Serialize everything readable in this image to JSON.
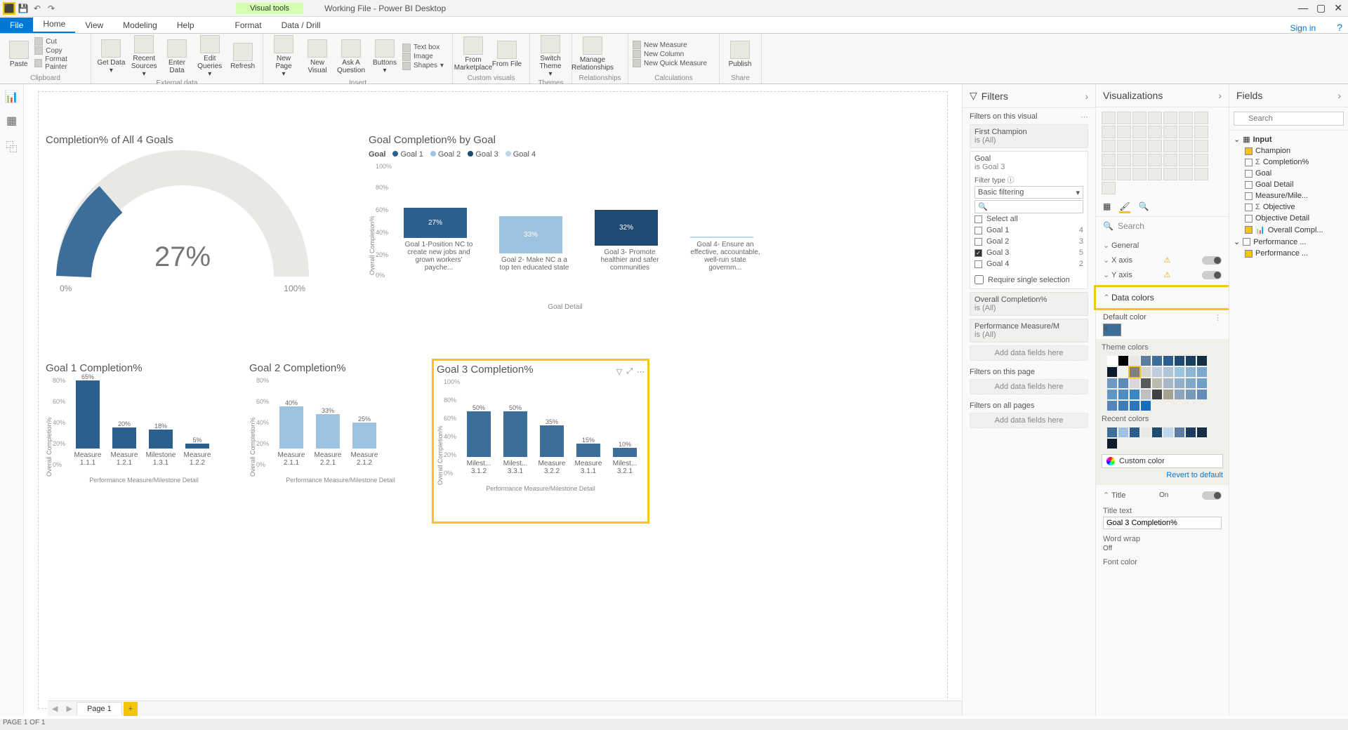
{
  "app": {
    "title": "Working File - Power BI Desktop",
    "visual_tools": "Visual tools",
    "sign_in": "Sign in"
  },
  "tabs": {
    "file": "File",
    "home": "Home",
    "view": "View",
    "modeling": "Modeling",
    "help": "Help",
    "format": "Format",
    "datadrill": "Data / Drill"
  },
  "ribbon": {
    "clipboard": {
      "paste": "Paste",
      "cut": "Cut",
      "copy": "Copy",
      "format_painter": "Format Painter",
      "label": "Clipboard"
    },
    "external": {
      "get_data": "Get Data",
      "recent_sources": "Recent Sources",
      "enter_data": "Enter Data",
      "edit_queries": "Edit Queries",
      "refresh": "Refresh",
      "label": "External data"
    },
    "insert": {
      "new_page": "New Page",
      "new_visual": "New Visual",
      "ask": "Ask A Question",
      "buttons": "Buttons",
      "textbox": "Text box",
      "image": "Image",
      "shapes": "Shapes",
      "label": "Insert"
    },
    "custom": {
      "marketplace": "From Marketplace",
      "file": "From File",
      "label": "Custom visuals"
    },
    "themes": {
      "switch": "Switch Theme",
      "label": "Themes"
    },
    "rel": {
      "manage": "Manage Relationships",
      "label": "Relationships"
    },
    "calc": {
      "new_measure": "New Measure",
      "new_column": "New Column",
      "quick": "New Quick Measure",
      "label": "Calculations"
    },
    "share": {
      "publish": "Publish",
      "label": "Share"
    }
  },
  "page_tab": "Page 1",
  "status": "PAGE 1 OF 1",
  "chart_data": [
    {
      "type": "gauge",
      "title": "Completion% of All 4 Goals",
      "value": 27,
      "min": "0%",
      "max": "100%"
    },
    {
      "type": "bar",
      "title": "Goal Completion% by Goal",
      "legend_label": "Goal",
      "series_names": [
        "Goal 1",
        "Goal 2",
        "Goal 3",
        "Goal 4"
      ],
      "categories": [
        "Goal 1-Position NC to create new jobs and grown workers' payche...",
        "Goal 2- Make NC a a top ten educated state",
        "Goal 3- Promote healthier and safer communities",
        "Goal 4- Ensure an effective, accountable, well-run state governm..."
      ],
      "values": [
        27,
        33,
        32,
        0
      ],
      "colors": [
        "#2c5f8d",
        "#9ec3e0",
        "#1f4b73",
        "#bcd6ea"
      ],
      "ylabel": "Overall Completion%",
      "xlabel": "Goal Detail",
      "ylim": [
        0,
        100
      ]
    },
    {
      "type": "bar",
      "title": "Goal 1 Completion%",
      "categories": [
        "Measure 1.1.1",
        "Measure 1.2.1",
        "Milestone 1.3.1",
        "Measure 1.2.2"
      ],
      "values": [
        65,
        20,
        18,
        5
      ],
      "color": "#2c5f8d",
      "ylabel": "Overall Completion%",
      "xlabel": "Performance Measure/Milestone Detail",
      "ylim": [
        0,
        80
      ]
    },
    {
      "type": "bar",
      "title": "Goal 2 Completion%",
      "categories": [
        "Measure 2.1.1",
        "Measure 2.2.1",
        "Measure 2.1.2"
      ],
      "values": [
        40,
        33,
        25
      ],
      "color": "#9ec3e0",
      "ylabel": "Overall Completion%",
      "xlabel": "Performance Measure/Milestone Detail",
      "ylim": [
        0,
        80
      ]
    },
    {
      "type": "bar",
      "title": "Goal 3 Completion%",
      "categories": [
        "Milest... 3.1.2",
        "Milest... 3.3.1",
        "Measure 3.2.2",
        "Measure 3.1.1",
        "Milest... 3.2.1"
      ],
      "values": [
        50,
        50,
        35,
        15,
        10
      ],
      "color": "#3d6e99",
      "ylabel": "Overall Completion%",
      "xlabel": "Performance Measure/Milestone Detail",
      "ylim": [
        0,
        100
      ]
    }
  ],
  "filters": {
    "header": "Filters",
    "on_visual": "Filters on this visual",
    "card1": {
      "name": "First Champion",
      "state": "is (All)"
    },
    "goal": {
      "name": "Goal",
      "state": "is Goal 3",
      "filter_type_lbl": "Filter type",
      "filter_type": "Basic filtering",
      "options": [
        {
          "label": "Select all",
          "checked": false,
          "count": ""
        },
        {
          "label": "Goal 1",
          "checked": false,
          "count": "4"
        },
        {
          "label": "Goal 2",
          "checked": false,
          "count": "3"
        },
        {
          "label": "Goal 3",
          "checked": true,
          "count": "5"
        },
        {
          "label": "Goal 4",
          "checked": false,
          "count": "2"
        }
      ],
      "single": "Require single selection"
    },
    "overall": {
      "name": "Overall Completion%",
      "state": "is (All)"
    },
    "perf": {
      "name": "Performance Measure/M",
      "state": "is (All)"
    },
    "add": "Add data fields here",
    "on_page": "Filters on this page",
    "on_all": "Filters on all pages"
  },
  "viz": {
    "header": "Visualizations",
    "search": "Search",
    "general": "General",
    "xaxis": "X axis",
    "yaxis": "Y axis",
    "data_colors": "Data colors",
    "default_color": "Default color",
    "theme_colors": "Theme colors",
    "recent_colors": "Recent colors",
    "custom_color": "Custom color",
    "revert": "Revert to default",
    "title": "Title",
    "on": "On",
    "title_text_lbl": "Title text",
    "title_text": "Goal 3 Completion%",
    "wordwrap": "Word wrap",
    "off": "Off",
    "fontcolor": "Font color"
  },
  "fields": {
    "header": "Fields",
    "search": "Search",
    "table": "Input",
    "items": [
      {
        "label": "Champion",
        "checked": true
      },
      {
        "label": "Completion%",
        "checked": false,
        "sigma": true
      },
      {
        "label": "Goal",
        "checked": false
      },
      {
        "label": "Goal Detail",
        "checked": false
      },
      {
        "label": "Measure/Mile...",
        "checked": false
      },
      {
        "label": "Objective",
        "checked": false,
        "sigma": true
      },
      {
        "label": "Objective Detail",
        "checked": false
      },
      {
        "label": "Overall Compl...",
        "checked": true,
        "measure": true
      },
      {
        "label": "Performance ...",
        "checked": false,
        "expand": true
      },
      {
        "label": "Performance ...",
        "checked": true
      }
    ]
  },
  "colors": {
    "theme": [
      "#ffffff",
      "#000000",
      "#e8e8e4",
      "#5b7da0",
      "#3d6e99",
      "#2c5f8d",
      "#1f4b73",
      "#1a3e5e",
      "#132e45",
      "#0c1e2e",
      "#f2f2f2",
      "#808080",
      "#d6d6cc",
      "#c0cedd",
      "#b0c6d8",
      "#9ec3e0",
      "#8eb5d6",
      "#7da7cb",
      "#6d99c1",
      "#5c8bb6",
      "#d9d9d9",
      "#595959",
      "#bcbcae",
      "#a6b8ca",
      "#94b0c9",
      "#82a8c8",
      "#709fc6",
      "#5e97c5",
      "#4c8ec3",
      "#3a86c2",
      "#bfbfbf",
      "#404040",
      "#a3a390",
      "#8ca3b8",
      "#789ab9",
      "#648cba",
      "#5185bb",
      "#3d7dbb",
      "#2976bc",
      "#156ebd"
    ],
    "recent": [
      "#3d6e99",
      "#9ec3e0",
      "#2c5f8d",
      "#e8e8e4",
      "#1f4b73",
      "#bcd6ea",
      "#5b7da0",
      "#1a3e5e",
      "#132e45",
      "#0c1e2e"
    ]
  }
}
